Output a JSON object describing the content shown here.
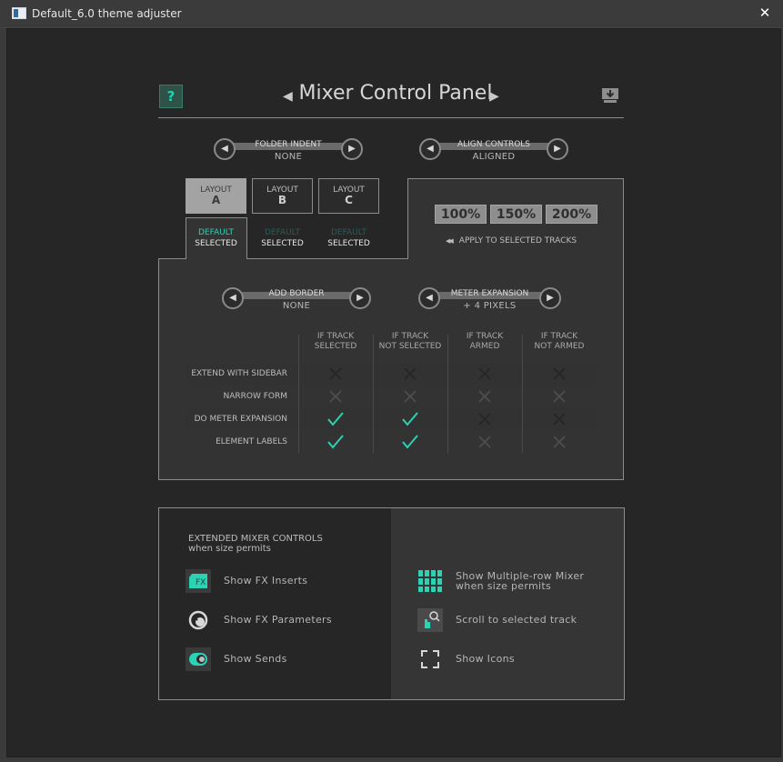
{
  "window": {
    "title": "Default_6.0 theme adjuster",
    "close": "✕"
  },
  "header": {
    "help": "?",
    "title": "Mixer Control Panel",
    "prev": "◀",
    "next": "▶"
  },
  "spinners": {
    "folder_indent": {
      "label": "FOLDER INDENT",
      "value": "NONE"
    },
    "align_controls": {
      "label": "ALIGN CONTROLS",
      "value": "ALIGNED"
    },
    "add_border": {
      "label": "ADD BORDER",
      "value": "NONE"
    },
    "meter_expansion": {
      "label": "METER EXPANSION",
      "value": "+ 4 PIXELS"
    },
    "left_arrow": "◀",
    "right_arrow": "▶"
  },
  "layouts": [
    {
      "label": "LAYOUT",
      "letter": "A",
      "default": "DEFAULT",
      "selected": "SELECTED",
      "active": true
    },
    {
      "label": "LAYOUT",
      "letter": "B",
      "default": "DEFAULT",
      "selected": "SELECTED",
      "active": false
    },
    {
      "label": "LAYOUT",
      "letter": "C",
      "default": "DEFAULT",
      "selected": "SELECTED",
      "active": false
    }
  ],
  "scale": {
    "options": [
      "100%",
      "150%",
      "200%"
    ],
    "apply_label": "APPLY TO SELECTED TRACKS",
    "apply_icon": "◀◀"
  },
  "matrix": {
    "columns": [
      [
        "IF TRACK",
        "SELECTED"
      ],
      [
        "IF TRACK",
        "NOT SELECTED"
      ],
      [
        "IF TRACK",
        "ARMED"
      ],
      [
        "IF TRACK",
        "NOT ARMED"
      ]
    ],
    "rows": [
      {
        "label": "EXTEND WITH SIDEBAR",
        "values": [
          "x-dim",
          "x-dim",
          "x-dim",
          "x-dim"
        ]
      },
      {
        "label": "NARROW FORM",
        "values": [
          "x",
          "x",
          "x",
          "x"
        ]
      },
      {
        "label": "DO METER EXPANSION",
        "values": [
          "check",
          "check",
          "x-dim",
          "x-dim"
        ]
      },
      {
        "label": "ELEMENT LABELS",
        "values": [
          "check",
          "check",
          "x",
          "x"
        ]
      }
    ]
  },
  "extended": {
    "title": "EXTENDED MIXER CONTROLS",
    "subtitle": "when size permits",
    "fx_badge": "FX",
    "left": [
      {
        "label": "Show FX Inserts",
        "icon": "fx-inserts-icon"
      },
      {
        "label": "Show FX Parameters",
        "icon": "fx-parameters-icon"
      },
      {
        "label": "Show Sends",
        "icon": "sends-icon"
      }
    ],
    "right": [
      {
        "label": "Show Multiple-row Mixer",
        "sub": "when size permits",
        "icon": "multirow-mixer-icon"
      },
      {
        "label": "Scroll to selected track",
        "icon": "scroll-to-track-icon"
      },
      {
        "label": "Show Icons",
        "icon": "show-icons-icon"
      }
    ]
  },
  "colors": {
    "accent": "#2ad3b3",
    "panel_border": "#8c8c8c",
    "background": "#262626"
  }
}
